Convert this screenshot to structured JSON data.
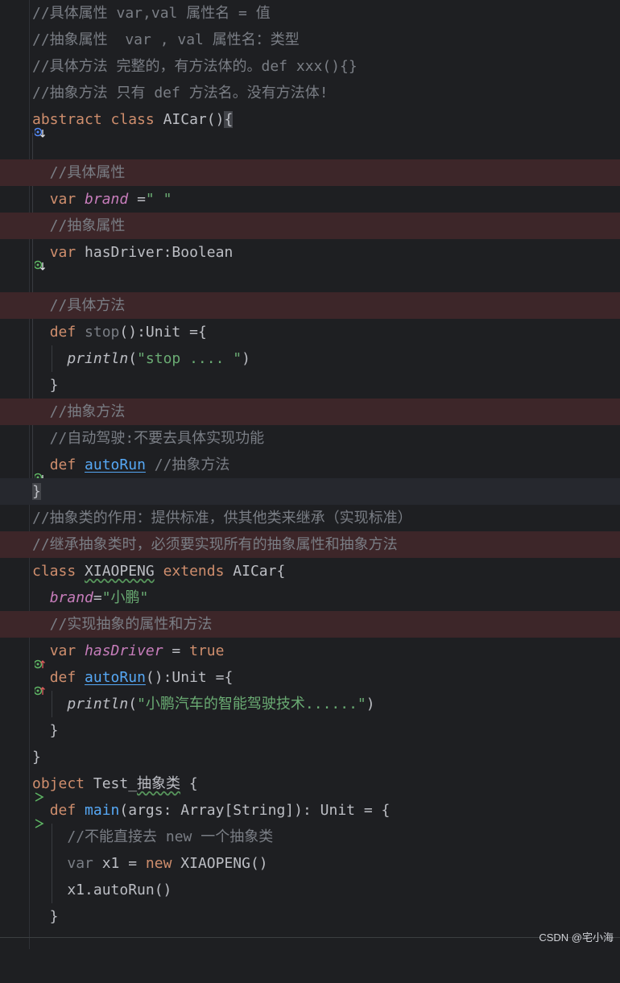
{
  "lines": [
    "//具体属性 var,val 属性名 = 值",
    "//抽象属性  var , val 属性名：类型",
    "//具体方法 完整的，有方法体的。def xxx(){}",
    "//抽象方法 只有 def 方法名。没有方法体!",
    "abstract class AICar(){",
    "",
    "  //具体属性",
    "  var brand =\" \"",
    "  //抽象属性",
    "  var hasDriver:Boolean",
    "",
    "  //具体方法",
    "  def stop():Unit ={",
    "    println(\"stop .... \")",
    "  }",
    "  //抽象方法",
    "  //自动驾驶:不要去具体实现功能",
    "  def autoRun //抽象方法",
    "}",
    "//抽象类的作用：提供标准，供其他类来继承（实现标准）",
    "//继承抽象类时，必须要实现所有的抽象属性和抽象方法",
    "class XIAOPENG extends AICar{",
    "  brand=\"小鹏\"",
    "  //实现抽象的属性和方法",
    "  var hasDriver = true",
    "  def autoRun():Unit ={",
    "    println(\"小鹏汽车的智能驾驶技术......\")",
    "  }",
    "}",
    "object Test_抽象类 {",
    "  def main(args: Array[String]): Unit = {",
    "    //不能直接去 new 一个抽象类",
    "    var x1 = new XIAOPENG()",
    "    x1.autoRun()",
    "  }"
  ],
  "watermark": "CSDN @宅小海",
  "gutter_icons": {
    "abstract_class": "implemented-icon",
    "abstract_prop": "implemented-icon",
    "abstract_method": "implemented-icon",
    "override_prop": "override-icon",
    "override_method": "override-icon",
    "run_object": "run-icon",
    "run_main": "run-icon"
  },
  "colors": {
    "background": "#1e1f22",
    "comment": "#7a7e85",
    "keyword": "#cf8e6d",
    "string": "#6aab73",
    "function": "#56a8f5",
    "property": "#c77dbb",
    "highlight": "#3d2629"
  }
}
